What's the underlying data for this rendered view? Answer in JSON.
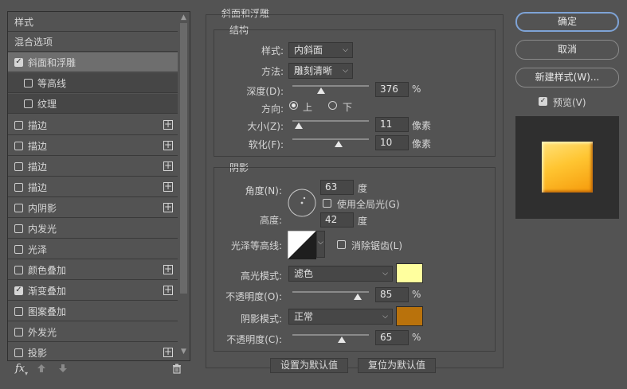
{
  "left_panel": {
    "header": "样式",
    "blend_options": "混合选项",
    "items": [
      {
        "label": "斜面和浮雕",
        "checked": true,
        "plus": false
      },
      {
        "label": "等高线",
        "checked": false,
        "plus": false
      },
      {
        "label": "纹理",
        "checked": false,
        "plus": false
      },
      {
        "label": "描边",
        "checked": false,
        "plus": true
      },
      {
        "label": "描边",
        "checked": false,
        "plus": true
      },
      {
        "label": "描边",
        "checked": false,
        "plus": true
      },
      {
        "label": "描边",
        "checked": false,
        "plus": true
      },
      {
        "label": "内阴影",
        "checked": false,
        "plus": true
      },
      {
        "label": "内发光",
        "checked": false,
        "plus": false
      },
      {
        "label": "光泽",
        "checked": false,
        "plus": false
      },
      {
        "label": "颜色叠加",
        "checked": false,
        "plus": true
      },
      {
        "label": "渐变叠加",
        "checked": true,
        "plus": true
      },
      {
        "label": "图案叠加",
        "checked": false,
        "plus": false
      },
      {
        "label": "外发光",
        "checked": false,
        "plus": false
      },
      {
        "label": "投影",
        "checked": false,
        "plus": true
      }
    ],
    "fx_label": "fx"
  },
  "bevel": {
    "title": "斜面和浮雕",
    "structure": {
      "title": "结构",
      "style_label": "样式:",
      "style_value": "内斜面",
      "technique_label": "方法:",
      "technique_value": "雕刻清晰",
      "depth_label": "深度(D):",
      "depth_value": "376",
      "depth_unit": "%",
      "depth_fraction": 0.37,
      "direction_label": "方向:",
      "direction_up": "上",
      "direction_down": "下",
      "size_label": "大小(Z):",
      "size_value": "11",
      "size_unit": "像素",
      "size_fraction": 0.08,
      "soften_label": "软化(F):",
      "soften_value": "10",
      "soften_unit": "像素",
      "soften_fraction": 0.6
    },
    "shading": {
      "title": "阴影",
      "angle_label": "角度(N):",
      "angle_value": "63",
      "angle_unit": "度",
      "global_light_label": "使用全局光(G)",
      "altitude_label": "高度:",
      "altitude_value": "42",
      "altitude_unit": "度",
      "gloss_contour_label": "光泽等高线:",
      "anti_alias_label": "消除锯齿(L)",
      "highlight_mode_label": "高光模式:",
      "highlight_mode_value": "滤色",
      "highlight_color": "#ffff9e",
      "highlight_opacity_label": "不透明度(O):",
      "highlight_opacity_value": "85",
      "highlight_opacity_fraction": 0.85,
      "shadow_mode_label": "阴影模式:",
      "shadow_mode_value": "正常",
      "shadow_color": "#b9720c",
      "shadow_opacity_label": "不透明度(C):",
      "shadow_opacity_value": "65",
      "shadow_opacity_fraction": 0.65,
      "percent": "%"
    },
    "set_default": "设置为默认值",
    "reset_default": "复位为默认值"
  },
  "buttons": {
    "ok": "确定",
    "cancel": "取消",
    "new_style": "新建样式(W)...",
    "preview_label": "预览(V)"
  }
}
